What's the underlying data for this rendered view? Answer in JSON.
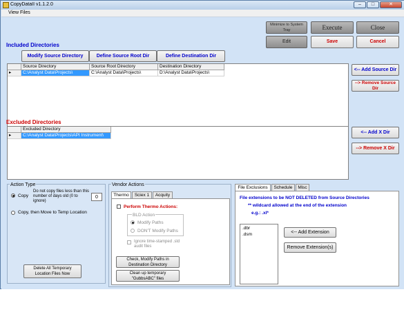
{
  "window": {
    "title": "CopyDataII v1.1.2.0"
  },
  "menu": {
    "view_files": "View Files"
  },
  "toolbar": {
    "minimize_tray": "Minimize to System Tray",
    "execute": "Execute",
    "close": "Close",
    "edit": "Edit",
    "save": "Save",
    "cancel": "Cancel"
  },
  "included": {
    "title": "Included Directories",
    "buttons": {
      "modify_source": "Modify Source Directory",
      "define_source_root": "Define Source Root Dir",
      "define_destination": "Define Destination Dir"
    },
    "columns": [
      "Source Directory",
      "Source Root Directory",
      "Destination Directory"
    ],
    "rows": [
      {
        "source": "C:\\Analyst Data\\Projects\\",
        "root": "C:\\Analyst Data\\Projects\\",
        "dest": "D:\\Analyst Data\\Projects\\"
      }
    ],
    "add": "<-- Add Source Dir",
    "remove": "--> Remove Source Dir"
  },
  "excluded": {
    "title": "Excluded Directories",
    "columns": [
      "Excluded Directory"
    ],
    "rows": [
      {
        "dir": "C:\\Analyst Data\\Projects\\API Instrument\\"
      }
    ],
    "add": "<-- Add X Dir",
    "remove": "--> Remove X Dir"
  },
  "action_type": {
    "title": "Action Type",
    "copy": "Copy",
    "no_copy_text": "Do not copy files less than this number of days old (0 to ignore)",
    "days_value": "0",
    "copy_move": "Copy, then Move to Temp Location",
    "delete_temp": "Delete All Temporary Location Files Now"
  },
  "vendor": {
    "title": "Vendor Actions",
    "tabs": [
      "Thermo",
      "Sciex 1",
      "Acquity"
    ],
    "perform_thermo": "Perform Thermo Actions:",
    "bld_action": "BLD Action",
    "modify_paths": "Modify Paths",
    "dont_modify": "DON'T Modify Paths",
    "ignore_time": "Ignore time-stamped .sld audit files",
    "check_modify": "Check, Modify Paths in Destination Directory",
    "cleanup": "Clean up temporary \"GubbsABC\" files"
  },
  "file_ex": {
    "tabs": [
      "File Exclusions",
      "Schedule",
      "Misc"
    ],
    "line1": "File extensions to be NOT DELETED from Source Directories",
    "line2": "** wildcard allowed at the end of the extension",
    "line3": "e.g.: .xl*",
    "list": [
      ".dbr",
      ".dsm"
    ],
    "add": "<-- Add Extension",
    "remove": "Remove Extension(s)"
  },
  "colors": {
    "accent_blue": "#0000cc",
    "accent_red": "#cc0000",
    "panel": "#d2e3f6",
    "selection": "#3399ff"
  }
}
